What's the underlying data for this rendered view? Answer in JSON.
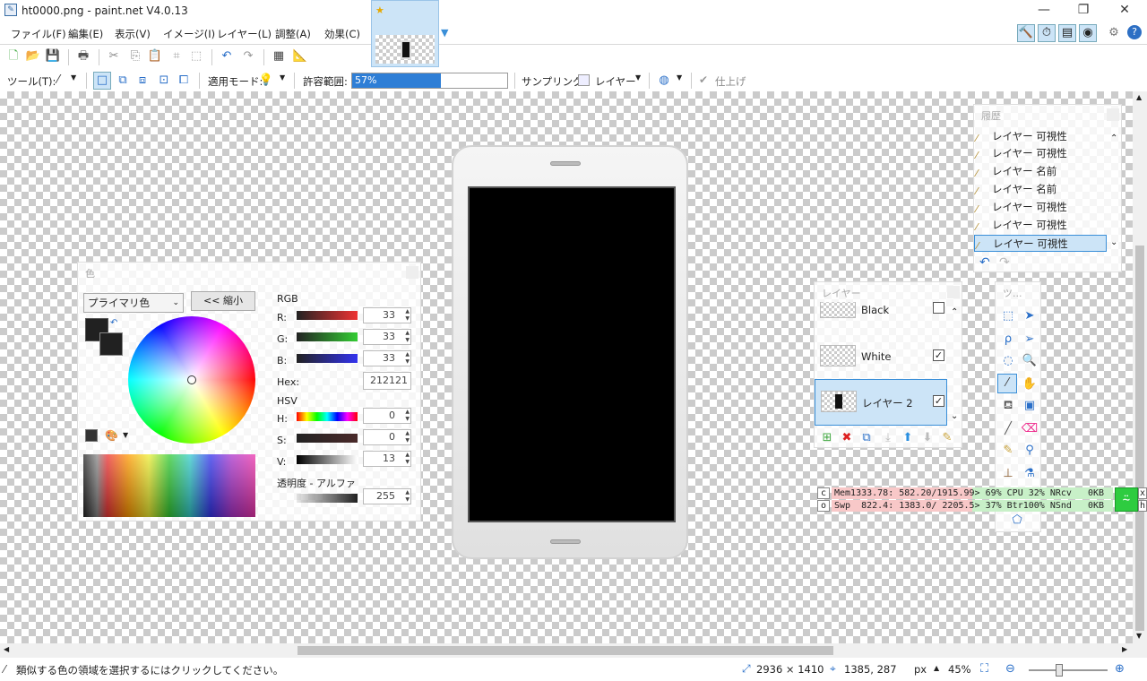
{
  "window": {
    "title": "ht0000.png - paint.net V4.0.13",
    "minimize": "—",
    "maximize": "❐",
    "close": "✕"
  },
  "menu": [
    "ファイル(F)",
    "編集(E)",
    "表示(V)",
    "イメージ(I)",
    "レイヤー(L)",
    "調整(A)",
    "効果(C)"
  ],
  "toolbar2": {
    "tool_label": "ツール(T):",
    "mode_label": "適用モード:",
    "tolerance_label": "許容範囲:",
    "tolerance_value": "57%",
    "tolerance_fraction": 0.57,
    "sampling_label": "サンプリング:",
    "sampling_value": "レイヤー",
    "finish_label": "仕上げ"
  },
  "history": {
    "title": "履歴",
    "items": [
      "レイヤー 可視性",
      "レイヤー 可視性",
      "レイヤー 名前",
      "レイヤー 名前",
      "レイヤー 可視性",
      "レイヤー 可視性",
      "レイヤー 可視性"
    ]
  },
  "layers": {
    "title": "レイヤー",
    "items": [
      {
        "name": "Black",
        "checked": ""
      },
      {
        "name": "White",
        "checked": "✓"
      },
      {
        "name": "レイヤー 2",
        "checked": "✓"
      }
    ]
  },
  "tools_panel": {
    "title": "ツ..."
  },
  "colors": {
    "title": "色",
    "primary_select": "プライマリ色",
    "shrink_button": "<< 縮小",
    "rgb_label": "RGB",
    "r_label": "R:",
    "r_value": "33",
    "g_label": "G:",
    "g_value": "33",
    "b_label": "B:",
    "b_value": "33",
    "hex_label": "Hex:",
    "hex_value": "212121",
    "hsv_label": "HSV",
    "h_label": "H:",
    "h_value": "0",
    "s_label": "S:",
    "s_value": "0",
    "v_label": "V:",
    "v_value": "13",
    "alpha_label": "透明度 - アルファ",
    "alpha_value": "255",
    "primary_color": "#212121"
  },
  "overlay": {
    "row1_key": "c",
    "row1_text": "Mem1333.78: 582.20/1915.99> 69% CPU 32% NRcv   0KB",
    "row1_btn": "x",
    "row2_key": "o",
    "row2_text": "Swp  822.4: 1383.0/ 2205.5> 37% Btr100% NSnd   0KB",
    "row2_btn": "h"
  },
  "status": {
    "hint": "類似する色の領域を選択するにはクリックしてください。",
    "image_size": "2936 × 1410",
    "cursor_pos": "1385, 287",
    "unit": "px",
    "zoom": "45%"
  }
}
